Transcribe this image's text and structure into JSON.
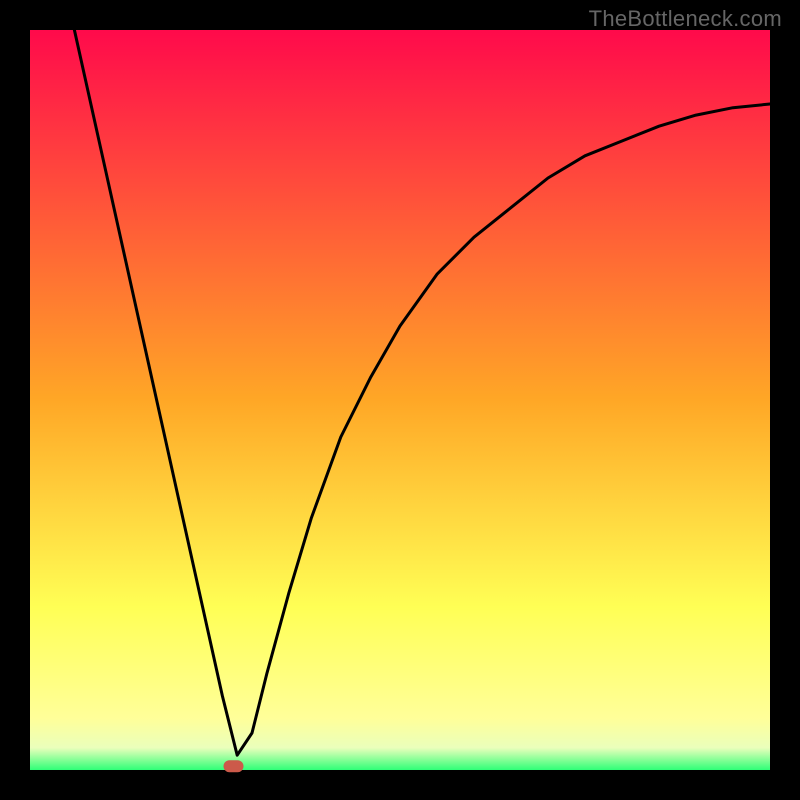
{
  "watermark": "TheBottleneck.com",
  "chart_data": {
    "type": "line",
    "title": "",
    "xlabel": "",
    "ylabel": "",
    "xlim": [
      0,
      100
    ],
    "ylim": [
      0,
      100
    ],
    "axes_visible": false,
    "background": {
      "type": "vertical-gradient",
      "stops": [
        {
          "offset": 0.0,
          "color": "#ff0a4b"
        },
        {
          "offset": 0.5,
          "color": "#ffa726"
        },
        {
          "offset": 0.78,
          "color": "#ffff55"
        },
        {
          "offset": 0.93,
          "color": "#ffff99"
        },
        {
          "offset": 0.97,
          "color": "#eaffbb"
        },
        {
          "offset": 1.0,
          "color": "#2fff77"
        }
      ]
    },
    "series": [
      {
        "name": "bottleneck-curve",
        "color": "#000000",
        "x": [
          6,
          8,
          10,
          12,
          14,
          16,
          18,
          20,
          22,
          24,
          26,
          28,
          30,
          32,
          35,
          38,
          42,
          46,
          50,
          55,
          60,
          65,
          70,
          75,
          80,
          85,
          90,
          95,
          100
        ],
        "y": [
          100,
          91,
          82,
          73,
          64,
          55,
          46,
          37,
          28,
          19,
          10,
          2,
          5,
          13,
          24,
          34,
          45,
          53,
          60,
          67,
          72,
          76,
          80,
          83,
          85,
          87,
          88.5,
          89.5,
          90
        ]
      }
    ],
    "markers": [
      {
        "name": "optimal-point",
        "shape": "rounded-rect",
        "x": 27.5,
        "y": 0.5,
        "color": "#cc5a4a"
      }
    ],
    "frame": {
      "border_color": "#000000",
      "border_width_px": 30
    }
  }
}
